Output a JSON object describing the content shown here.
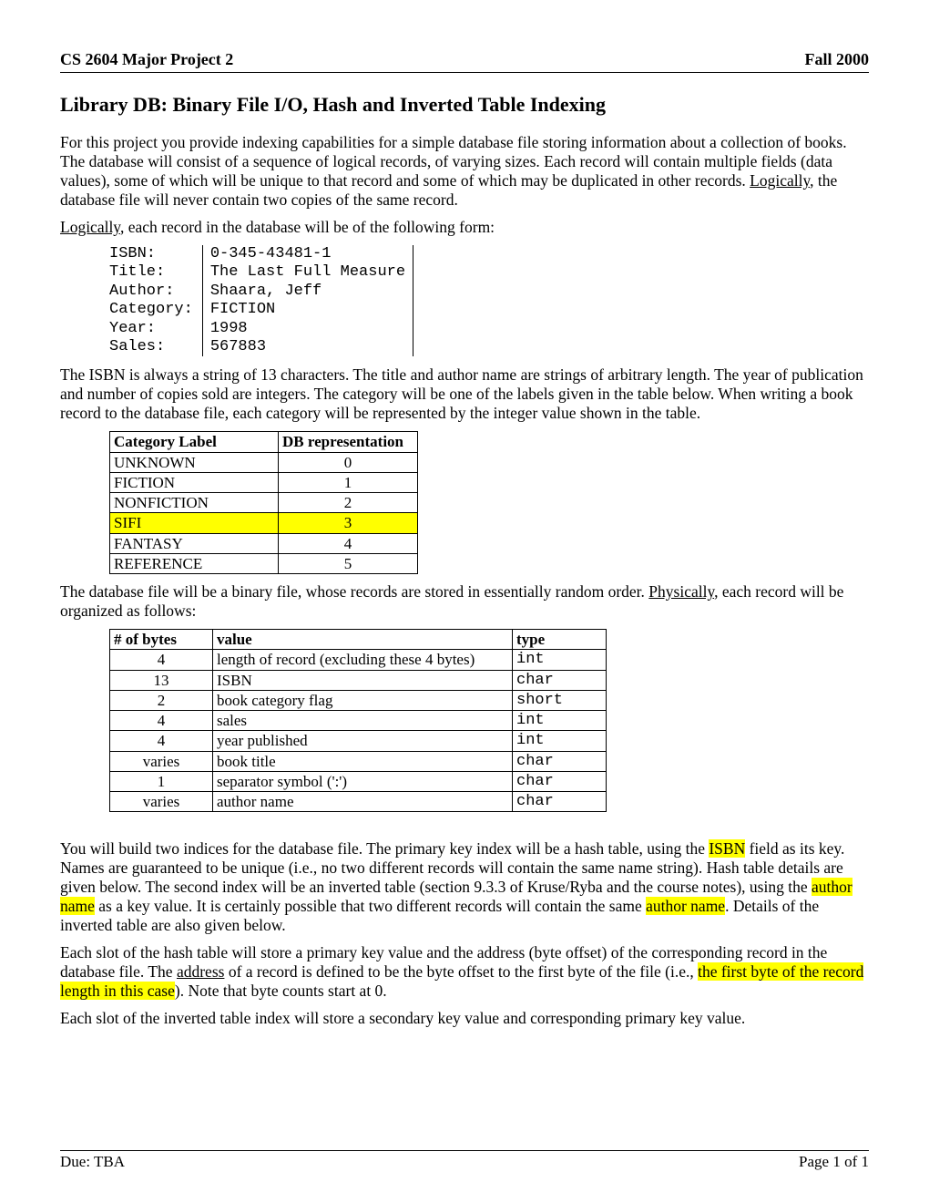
{
  "header": {
    "left": "CS 2604   Major Project 2",
    "right": "Fall 2000"
  },
  "title": "Library DB:  Binary File I/O, Hash and Inverted Table Indexing",
  "para1_a": "For this project you provide indexing capabilities for a simple database file storing information about a collection of books.  The database will consist of a sequence of logical records, of varying sizes.  Each record will contain multiple fields (data values), some of which will be unique to that record and some of which may be duplicated in other records.  ",
  "para1_logically": "Logically",
  "para1_b": ", the database file will never contain two copies of the same record.",
  "para2_a": "",
  "para2_logically": "Logically",
  "para2_b": ", each record in the database will be of the following form:",
  "record_labels": "ISBN:\nTitle:\nAuthor:\nCategory:\nYear:\nSales:",
  "record_values": "0-345-43481-1\nThe Last Full Measure\nShaara, Jeff\nFICTION\n1998\n567883",
  "para3": "The ISBN is always a string of 13 characters.  The title and author name are strings of arbitrary length.  The year of publication and number of copies sold are integers.  The category will be one of the labels given in the table below.  When writing a book record to the database file, each category will be represented by the integer value shown in the table.",
  "cat_table": {
    "headers": [
      "Category Label",
      "DB representation"
    ],
    "rows": [
      {
        "label": "UNKNOWN",
        "rep": "0",
        "hl": false
      },
      {
        "label": "FICTION",
        "rep": "1",
        "hl": false
      },
      {
        "label": "NONFICTION",
        "rep": "2",
        "hl": false
      },
      {
        "label": "SIFI",
        "rep": "3",
        "hl": true
      },
      {
        "label": "FANTASY",
        "rep": "4",
        "hl": false
      },
      {
        "label": "REFERENCE",
        "rep": "5",
        "hl": false
      }
    ]
  },
  "para4_a": "The database file will be a binary file, whose records are stored in essentially random order.  ",
  "para4_phys": "Physically",
  "para4_b": ", each record will be organized as follows:",
  "bytes_table": {
    "headers": [
      "# of bytes",
      "value",
      "type"
    ],
    "rows": [
      {
        "b": "4",
        "v": "length of record (excluding these 4 bytes)",
        "t": "int"
      },
      {
        "b": "13",
        "v": "ISBN",
        "t": "char"
      },
      {
        "b": "2",
        "v": "book category flag",
        "t": "short"
      },
      {
        "b": "4",
        "v": "sales",
        "t": "int"
      },
      {
        "b": "4",
        "v": "year published",
        "t": "int"
      },
      {
        "b": "varies",
        "v": "book title",
        "t": "char"
      },
      {
        "b": "1",
        "v": "separator symbol (':')",
        "t": "char"
      },
      {
        "b": "varies",
        "v": "author name",
        "t": "char"
      }
    ]
  },
  "para5_a": "You will build two indices for the database file.  The primary key index will be a hash table, using the ",
  "para5_isbn": "ISBN",
  "para5_b": " field as its key.  Names are guaranteed to be unique (i.e., no two different records will contain the same name string).  Hash table details are given below.  The second index will be an inverted table (section 9.3.3 of Kruse/Ryba and the course notes), using the ",
  "para5_author1": "author name",
  "para5_c": " as a key value.  It is certainly possible that two different records will contain the same ",
  "para5_author2": "author name",
  "para5_d": ".  Details of the inverted table are also given below.",
  "para6_a": "Each slot of the hash table will store a primary key value and the address (byte offset) of the corresponding record in the database file.  The ",
  "para6_addr": "address",
  "para6_b": " of a record is defined to be the byte offset to the first byte of the file (i.e., ",
  "para6_hl": "the first byte of the record length in this case",
  "para6_c": ").  Note that byte counts start at 0.",
  "para7": "Each slot of the inverted table index will store a secondary key value and corresponding primary key value.",
  "footer": {
    "left": "Due: TBA",
    "right": "Page 1 of 1"
  }
}
